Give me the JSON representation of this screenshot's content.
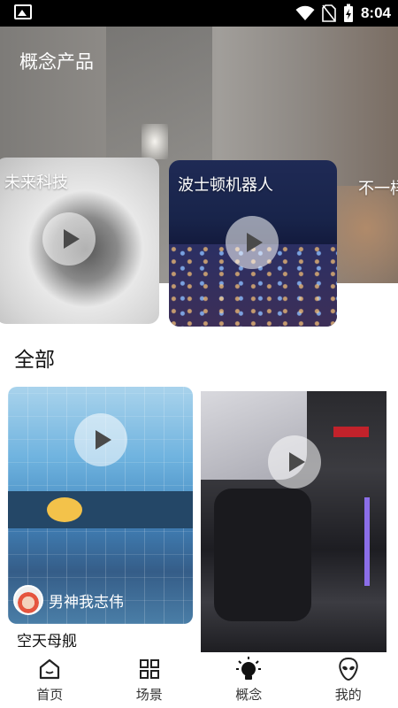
{
  "status_bar": {
    "time": "8:04"
  },
  "hero": {
    "title": "概念产品",
    "cards": [
      {
        "title": "未来科技"
      },
      {
        "title": "波士顿机器人"
      },
      {
        "title": "不一样"
      }
    ]
  },
  "section": {
    "title": "全部"
  },
  "grid": [
    {
      "user": "男神我志伟",
      "caption": "空天母舰"
    },
    {
      "user": "",
      "caption": ""
    }
  ],
  "nav": [
    {
      "label": "首页",
      "icon": "home-icon"
    },
    {
      "label": "场景",
      "icon": "grid-icon"
    },
    {
      "label": "概念",
      "icon": "lightbulb-icon",
      "active": true
    },
    {
      "label": "我的",
      "icon": "alien-icon"
    }
  ]
}
